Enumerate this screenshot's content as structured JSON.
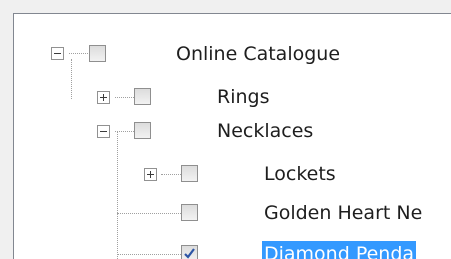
{
  "tree": {
    "nodes": [
      {
        "label": "Online Catalogue",
        "expanded": true,
        "checked": false
      },
      {
        "label": "Rings",
        "expanded": false,
        "checked": false
      },
      {
        "label": "Necklaces",
        "expanded": true,
        "checked": false
      },
      {
        "label": "Lockets",
        "expanded": false,
        "checked": false
      },
      {
        "label": "Golden Heart Ne",
        "checked": false
      },
      {
        "label": "Diamond Penda",
        "checked": true,
        "selected": true
      }
    ]
  },
  "colors": {
    "selection": "#3399ff",
    "check": "#2d55a5"
  }
}
